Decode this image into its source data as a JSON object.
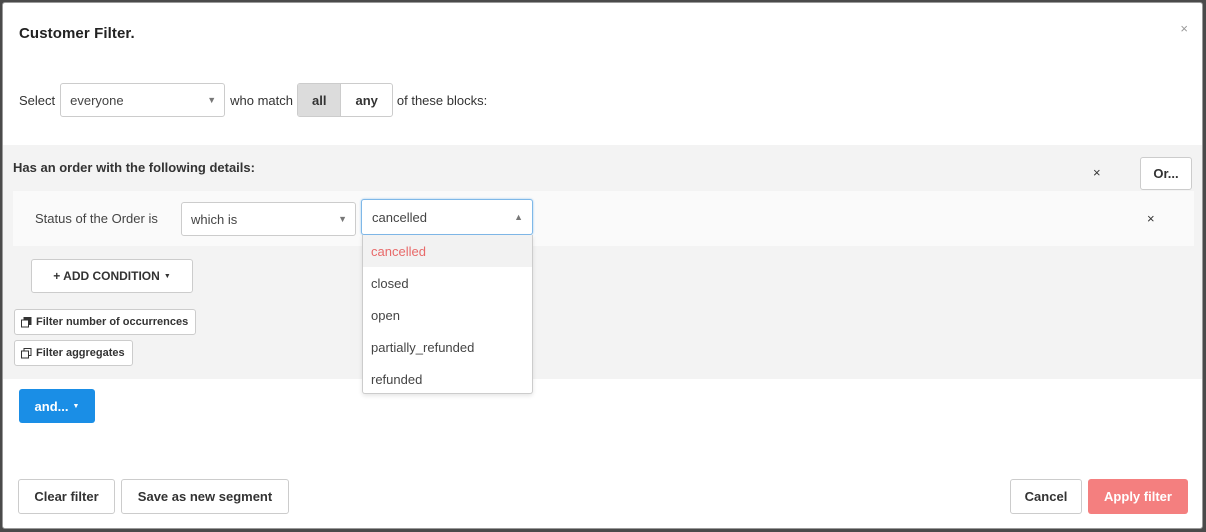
{
  "modal": {
    "title": "Customer Filter.",
    "close": "×"
  },
  "select_row": {
    "select_label": "Select",
    "audience_value": "everyone",
    "match_label": "who match",
    "match_options": [
      "all",
      "any"
    ],
    "match_selected": "all",
    "suffix": "of these blocks:"
  },
  "block": {
    "heading": "Has an order with the following details:",
    "remove": "×",
    "or_label": "Or...",
    "condition": {
      "label": "Status of the Order is",
      "operator_value": "which is",
      "status_value": "cancelled",
      "remove": "×"
    },
    "add_condition_label": "+ ADD CONDITION",
    "filter_occurrences_label": "Filter number of occurrences",
    "filter_aggregates_label": "Filter aggregates"
  },
  "status_options": [
    "cancelled",
    "closed",
    "open",
    "partially_refunded",
    "refunded"
  ],
  "and_label": "and...",
  "footer": {
    "clear_label": "Clear filter",
    "save_segment_label": "Save as new segment",
    "cancel_label": "Cancel",
    "apply_label": "Apply filter"
  },
  "colors": {
    "primary_blue": "#1a8ee6",
    "apply_red": "#f47f7f",
    "active_option_text": "#e86a6a"
  }
}
